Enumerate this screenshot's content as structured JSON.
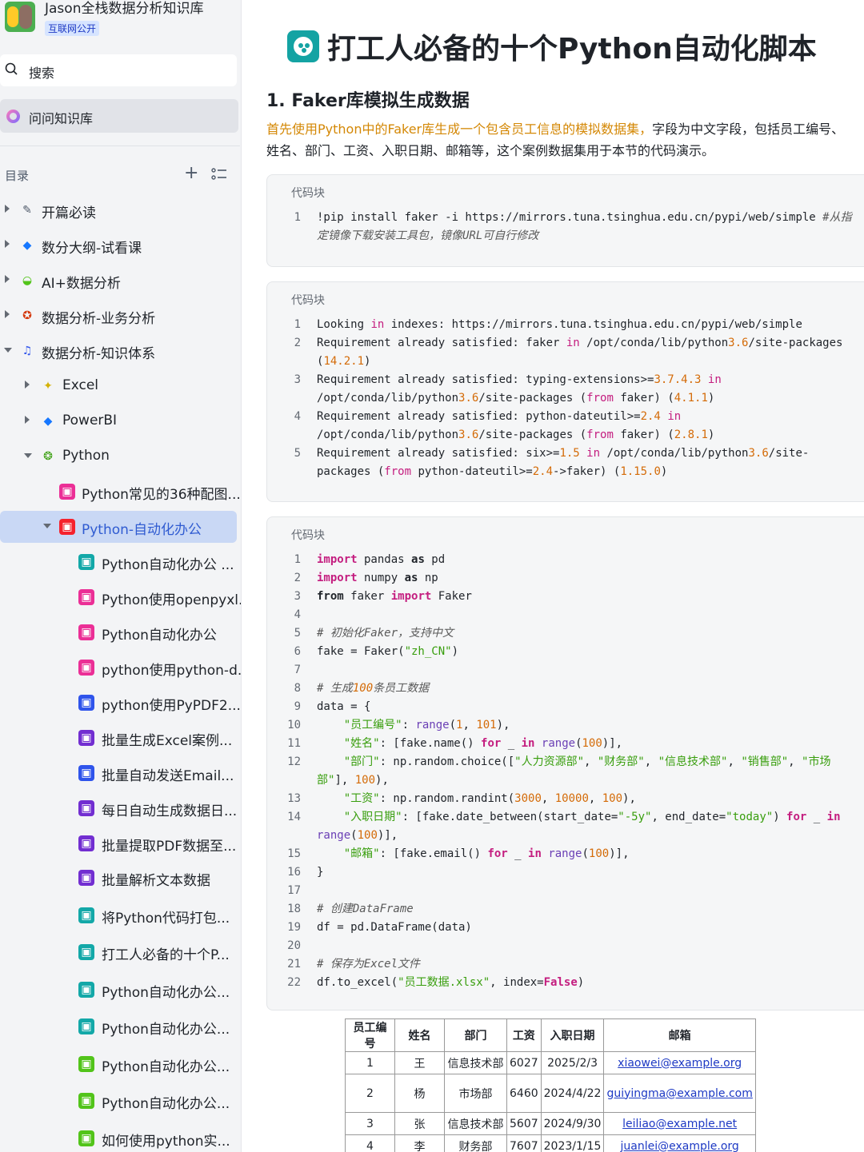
{
  "sidebar": {
    "kb_title": "Jason全栈数据分析知识库",
    "kb_badge": "互联网公开",
    "search_label": "搜索",
    "ask_label": "问问知识库",
    "toc_label": "目录",
    "items": [
      {
        "label": "开篇必读",
        "icon": "memo-icon",
        "color": "#4e5969"
      },
      {
        "label": "数分大纲-试看课",
        "icon": "gem-icon",
        "color": "#1677ff"
      },
      {
        "label": "AI+数据分析",
        "icon": "ufo-icon",
        "color": "#52c41a"
      },
      {
        "label": "数据分析-业务分析",
        "icon": "medal-icon",
        "color": "#d4380d"
      },
      {
        "label": "数据分析-知识体系",
        "icon": "music-icon",
        "color": "#2f54eb"
      },
      {
        "label": "Excel",
        "icon": "sparkle-icon",
        "color": "#d4b106"
      },
      {
        "label": "PowerBI",
        "icon": "gem-icon",
        "color": "#1677ff"
      },
      {
        "label": "Python",
        "icon": "fox-icon",
        "color": "#389e0d"
      },
      {
        "label": "Python常见的36种配图...",
        "icon": "doc-icon",
        "color": "#eb2f96"
      },
      {
        "label": "Python-自动化办公",
        "icon": "doc-icon",
        "color": "#f5222d"
      },
      {
        "label": "Python自动化办公 ...",
        "icon": "doc-icon",
        "color": "#13a8a8"
      },
      {
        "label": "Python使用openpyxl...",
        "icon": "doc-icon",
        "color": "#eb2f96"
      },
      {
        "label": "Python自动化办公",
        "icon": "doc-icon",
        "color": "#eb2f96"
      },
      {
        "label": "python使用python-d...",
        "icon": "doc-icon",
        "color": "#eb2f96"
      },
      {
        "label": "python使用PyPDF2...",
        "icon": "doc-icon",
        "color": "#2f54eb"
      },
      {
        "label": "批量生成Excel案例...",
        "icon": "doc-icon",
        "color": "#722ed1"
      },
      {
        "label": "批量自动发送Email...",
        "icon": "doc-icon",
        "color": "#2f54eb"
      },
      {
        "label": "每日自动生成数据日...",
        "icon": "doc-icon",
        "color": "#722ed1"
      },
      {
        "label": "批量提取PDF数据至...",
        "icon": "doc-icon",
        "color": "#722ed1"
      },
      {
        "label": "批量解析文本数据",
        "icon": "doc-icon",
        "color": "#722ed1"
      },
      {
        "label": "将Python代码打包...",
        "icon": "doc-icon",
        "color": "#13a8a8"
      },
      {
        "label": "打工人必备的十个P...",
        "icon": "doc-icon",
        "color": "#13a8a8"
      },
      {
        "label": "Python自动化办公...",
        "icon": "doc-icon",
        "color": "#13a8a8"
      },
      {
        "label": "Python自动化办公...",
        "icon": "doc-icon",
        "color": "#13a8a8"
      },
      {
        "label": "Python自动化办公...",
        "icon": "doc-icon",
        "color": "#52c41a"
      },
      {
        "label": "Python自动化办公...",
        "icon": "doc-icon",
        "color": "#52c41a"
      },
      {
        "label": "如何使用python实...",
        "icon": "doc-icon",
        "color": "#52c41a"
      }
    ]
  },
  "doc": {
    "title": "打工人必备的十个Python自动化脚本",
    "section_heading": "1. Faker库模拟生成数据",
    "intro_highlight": "首先使用Python中的Faker库生成一个包含员工信息的模拟数据集，",
    "intro_rest": "字段为中文字段，包括员工编号、姓名、部门、工资、入职日期、邮箱等，这个案例数据集用于本节的代码演示。",
    "code_label": "代码块",
    "block1": {
      "lines": [
        {
          "n": "1",
          "text": "!pip install faker -i https://mirrors.tuna.tsinghua.edu.cn/pypi/web/simple #从指定镜像下载安装工具包，镜像URL可自行修改"
        }
      ]
    },
    "block2": {
      "lines": [
        {
          "n": "1",
          "text": "Looking in indexes: https://mirrors.tuna.tsinghua.edu.cn/pypi/web/simple"
        },
        {
          "n": "2",
          "text": "Requirement already satisfied: faker in /opt/conda/lib/python3.6/site-packages (14.2.1)"
        },
        {
          "n": "3",
          "text": "Requirement already satisfied: typing-extensions>=3.7.4.3 in /opt/conda/lib/python3.6/site-packages (from faker) (4.1.1)"
        },
        {
          "n": "4",
          "text": "Requirement already satisfied: python-dateutil>=2.4 in /opt/conda/lib/python3.6/site-packages (from faker) (2.8.1)"
        },
        {
          "n": "5",
          "text": "Requirement already satisfied: six>=1.5 in /opt/conda/lib/python3.6/site-packages (from python-dateutil>=2.4->faker) (1.15.0)"
        }
      ]
    },
    "block3": {
      "lines": [
        {
          "n": "1",
          "text": "import pandas as pd"
        },
        {
          "n": "2",
          "text": "import numpy as np"
        },
        {
          "n": "3",
          "text": "from faker import Faker"
        },
        {
          "n": "4",
          "text": ""
        },
        {
          "n": "5",
          "text": "# 初始化Faker，支持中文"
        },
        {
          "n": "6",
          "text": "fake = Faker(\"zh_CN\")"
        },
        {
          "n": "7",
          "text": ""
        },
        {
          "n": "8",
          "text": "# 生成100条员工数据"
        },
        {
          "n": "9",
          "text": "data = {"
        },
        {
          "n": "10",
          "text": "    \"员工编号\": range(1, 101),"
        },
        {
          "n": "11",
          "text": "    \"姓名\": [fake.name() for _ in range(100)],"
        },
        {
          "n": "12",
          "text": "    \"部门\": np.random.choice([\"人力资源部\", \"财务部\", \"信息技术部\", \"销售部\", \"市场部\"], 100),"
        },
        {
          "n": "13",
          "text": "    \"工资\": np.random.randint(3000, 10000, 100),"
        },
        {
          "n": "14",
          "text": "    \"入职日期\": [fake.date_between(start_date=\"-5y\", end_date=\"today\") for _ in range(100)],"
        },
        {
          "n": "15",
          "text": "    \"邮箱\": [fake.email() for _ in range(100)],"
        },
        {
          "n": "16",
          "text": "}"
        },
        {
          "n": "17",
          "text": ""
        },
        {
          "n": "18",
          "text": "# 创建DataFrame"
        },
        {
          "n": "19",
          "text": "df = pd.DataFrame(data)"
        },
        {
          "n": "20",
          "text": ""
        },
        {
          "n": "21",
          "text": "# 保存为Excel文件"
        },
        {
          "n": "22",
          "text": "df.to_excel(\"员工数据.xlsx\", index=False)"
        }
      ]
    },
    "table": {
      "headers": [
        "员工编号",
        "姓名",
        "部门",
        "工资",
        "入职日期",
        "邮箱"
      ],
      "rows": [
        [
          "1",
          "王",
          "信息技术部",
          "6027",
          "2025/2/3",
          "xiaowei@example.org"
        ],
        [
          "2",
          "杨",
          "市场部",
          "6460",
          "2024/4/22",
          "guiyingma@example.com"
        ],
        [
          "3",
          "张",
          "信息技术部",
          "5607",
          "2024/9/30",
          "leiliao@example.net"
        ],
        [
          "4",
          "李",
          "财务部",
          "7607",
          "2023/1/15",
          "juanlei@example.org"
        ]
      ]
    }
  }
}
